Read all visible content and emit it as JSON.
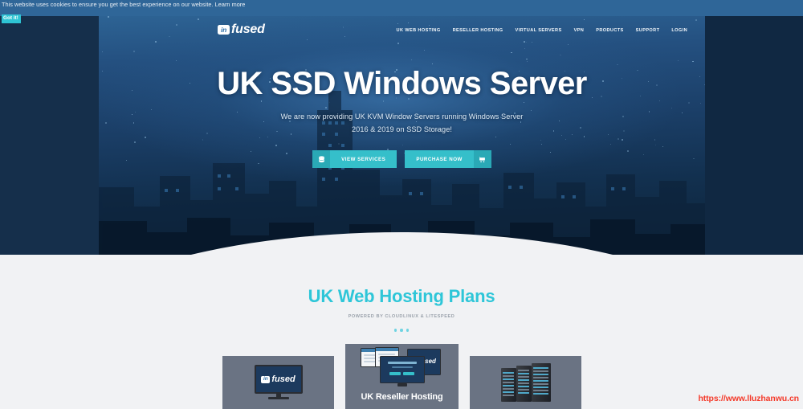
{
  "cookie": {
    "message": "This website uses cookies to ensure you get the best experience on our website.",
    "learn_more": "Learn more",
    "accept_label": "Got it!",
    "bar_color": "#2f6698",
    "accept_color": "#2ec4d4"
  },
  "header": {
    "logo_mark": "in",
    "logo_word": "fused",
    "nav": [
      {
        "label": "UK WEB HOSTING"
      },
      {
        "label": "RESELLER HOSTING"
      },
      {
        "label": "VIRTUAL SERVERS"
      },
      {
        "label": "VPN"
      },
      {
        "label": "PRODUCTS"
      },
      {
        "label": "SUPPORT"
      },
      {
        "label": "LOGIN"
      }
    ]
  },
  "hero": {
    "title": "UK SSD Windows Server",
    "subtitle_line_1": "We are now providing UK KVM Window Servers running Windows Server",
    "subtitle_line_2": "2016 & 2019 on SSD Storage!",
    "buttons": [
      {
        "label": "VIEW SERVICES",
        "icon": "server-icon",
        "icon_side": "left"
      },
      {
        "label": "PURCHASE NOW",
        "icon": "shopping-cart-icon",
        "icon_side": "right"
      }
    ],
    "accent_color": "#35bfca"
  },
  "plans": {
    "title": "UK Web Hosting Plans",
    "subtitle": "POWERED BY CLOUDLINUX & LITESPEED",
    "title_color": "#2ec6d8",
    "dots": 3,
    "cards": [
      {
        "title": "",
        "media": "desktop-monitor-icon",
        "logo_mark": "in",
        "logo_word": "fused"
      },
      {
        "title": "UK Reseller Hosting",
        "media": "multi-device-icon",
        "logo_mark": "in",
        "logo_word": "fused"
      },
      {
        "title": "",
        "media": "server-rack-icon"
      }
    ]
  },
  "watermark": {
    "text": "https://www.lluzhanwu.cn",
    "color": "#f43a2a"
  }
}
